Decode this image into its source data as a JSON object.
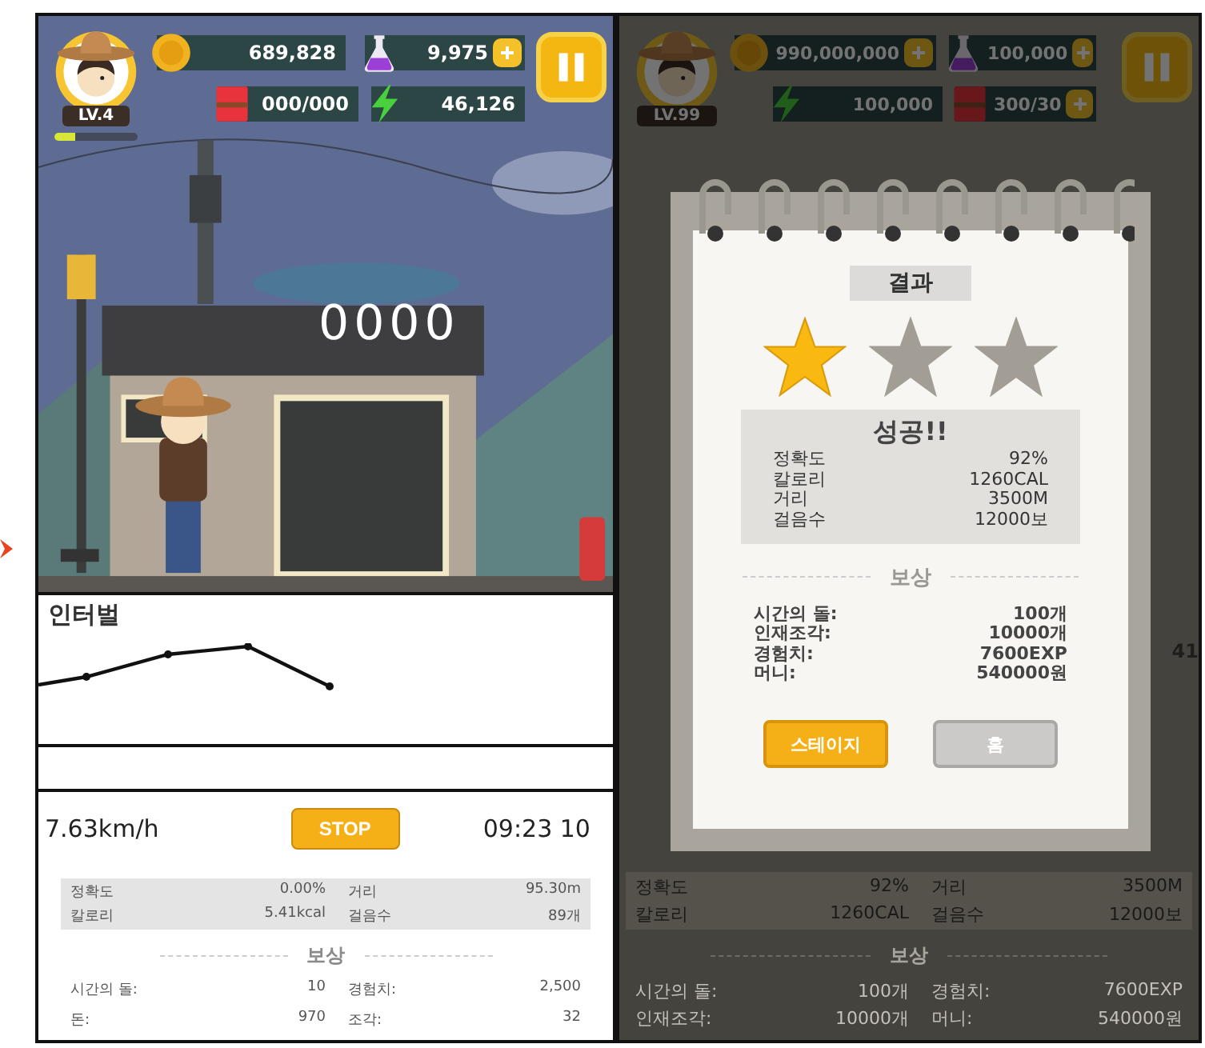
{
  "left_screen": {
    "hud": {
      "level": "LV.4",
      "xp": {
        "level": 0.25
      },
      "counters": [
        {
          "kind": "coin",
          "value": "689,828",
          "plus": false
        },
        {
          "kind": "potion",
          "value": "9,975",
          "plus": true
        },
        {
          "kind": "book",
          "value": "000/000",
          "plus": false
        },
        {
          "kind": "energy",
          "value": "46,126",
          "plus": false
        }
      ]
    },
    "sign": "0000",
    "interval_panel": {
      "title": "인터벌"
    },
    "workout": {
      "speed": "7.63km/h",
      "stop_button": "STOP",
      "time": "09:23 10",
      "stats": [
        {
          "label": "정확도",
          "value": "0.00%"
        },
        {
          "label": "거리",
          "value": "95.30m"
        },
        {
          "label": "칼로리",
          "value": "5.41kcal"
        },
        {
          "label": "걸음수",
          "value": "89개"
        }
      ],
      "reward_title": "보상",
      "rewards": [
        {
          "label": "시간의 돌:",
          "value": "10"
        },
        {
          "label": "경험치:",
          "value": "2,500"
        },
        {
          "label": "돈:",
          "value": "970"
        },
        {
          "label": "조각:",
          "value": "32"
        }
      ]
    }
  },
  "right_screen": {
    "hud": {
      "level": "LV.99",
      "counters": [
        {
          "kind": "coin",
          "value": "990,000,000",
          "plus": true
        },
        {
          "kind": "potion",
          "value": "100,000",
          "plus": true
        },
        {
          "kind": "energy",
          "value": "100,000",
          "plus": false
        },
        {
          "kind": "book",
          "value": "300/30",
          "plus": true
        }
      ]
    },
    "cut_text": "41",
    "result_dialog": {
      "title": "결과",
      "stars": 1,
      "heading": "성공!!",
      "stats": [
        {
          "label": "정확도",
          "value": "92%"
        },
        {
          "label": "칼로리",
          "value": "1260CAL"
        },
        {
          "label": "거리",
          "value": "3500M"
        },
        {
          "label": "걸음수",
          "value": "12000보"
        }
      ],
      "reward_title": "보상",
      "rewards": [
        {
          "label": "시간의 돌:",
          "value": "100개"
        },
        {
          "label": "인재조각:",
          "value": "10000개"
        },
        {
          "label": "경험치:",
          "value": "7600EXP"
        },
        {
          "label": "머니:",
          "value": "540000원"
        }
      ],
      "buttons": [
        {
          "label": "스테이지",
          "kind": "primary"
        },
        {
          "label": "홈",
          "kind": "secondary"
        }
      ]
    },
    "background_stats": {
      "stats": [
        {
          "label": "정확도",
          "value": "92%"
        },
        {
          "label": "거리",
          "value": "3500M"
        },
        {
          "label": "칼로리",
          "value": "1260CAL"
        },
        {
          "label": "걸음수",
          "value": "12000보"
        }
      ],
      "reward_title": "보상",
      "rewards": [
        {
          "label": "시간의 돌:",
          "value": "100개"
        },
        {
          "label": "경험치:",
          "value": "7600EXP"
        },
        {
          "label": "인재조각:",
          "value": "10000개"
        },
        {
          "label": "머니:",
          "value": "540000원"
        }
      ]
    }
  }
}
